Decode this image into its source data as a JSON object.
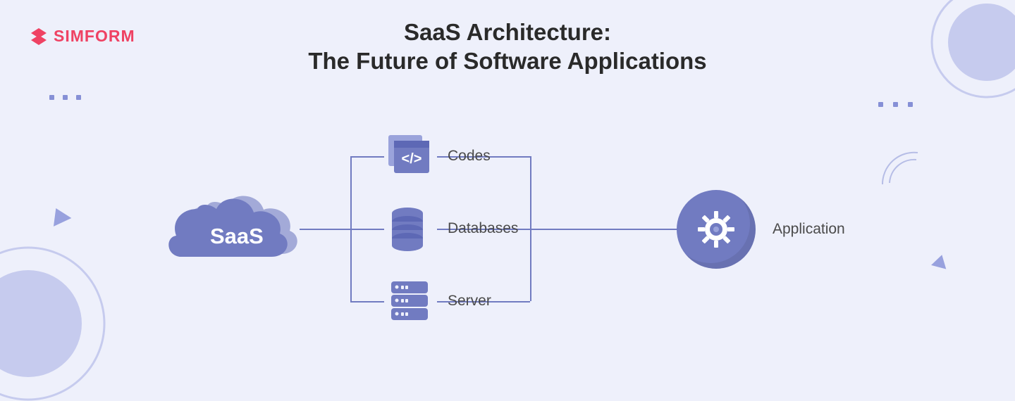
{
  "logo": {
    "text": "SIMFORM"
  },
  "title": {
    "line1": "SaaS Architecture:",
    "line2": "The Future of Software Applications"
  },
  "diagram": {
    "cloud_label": "SaaS",
    "nodes": [
      {
        "label": "Codes"
      },
      {
        "label": "Databases"
      },
      {
        "label": "Server"
      }
    ],
    "application_label": "Application"
  },
  "colors": {
    "bg": "#eef0fb",
    "brand": "#ef4263",
    "primary": "#717bc1",
    "text": "#2a2a2a"
  }
}
